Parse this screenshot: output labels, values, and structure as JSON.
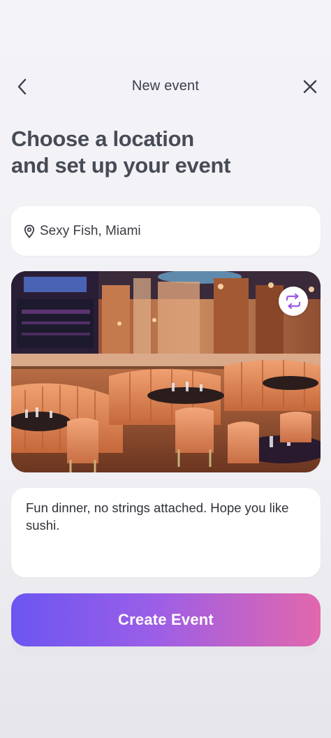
{
  "header": {
    "title": "New event",
    "back_icon": "chevron-left-icon",
    "close_icon": "close-icon"
  },
  "page_title_line1": "Choose a location",
  "page_title_line2": "and set up your event",
  "location": {
    "value": "Sexy Fish, Miami",
    "icon": "map-pin-icon"
  },
  "photo": {
    "alt": "Restaurant interior photo",
    "swap_icon": "swap-arrows-icon"
  },
  "description": {
    "value": "Fun dinner, no strings attached. Hope you like sushi."
  },
  "create_button": {
    "label": "Create Event"
  },
  "colors": {
    "accent_start": "#6b55f1",
    "accent_end": "#e267ad",
    "swap_icon": "#9b5de5"
  }
}
